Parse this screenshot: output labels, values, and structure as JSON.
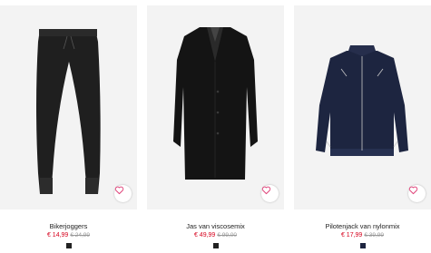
{
  "products": [
    {
      "name": "Bikerjoggers",
      "sale_price": "€ 14,99",
      "original_price": "€ 24,99",
      "color": "#1f1f1f",
      "swatch": "#222222",
      "favorite_icon": "heart-icon"
    },
    {
      "name": "Jas van viscosemix",
      "sale_price": "€ 49,99",
      "original_price": "€ 99,00",
      "color": "#141414",
      "swatch": "#222222",
      "favorite_icon": "heart-icon"
    },
    {
      "name": "Pilotenjack van nylonmix",
      "sale_price": "€ 17,99",
      "original_price": "€ 39,99",
      "color": "#1d2540",
      "swatch": "#1e2540",
      "favorite_icon": "heart-icon"
    }
  ],
  "colors": {
    "accent": "#d6001c",
    "heart": "#e0457b",
    "image_bg": "#f3f3f3"
  }
}
